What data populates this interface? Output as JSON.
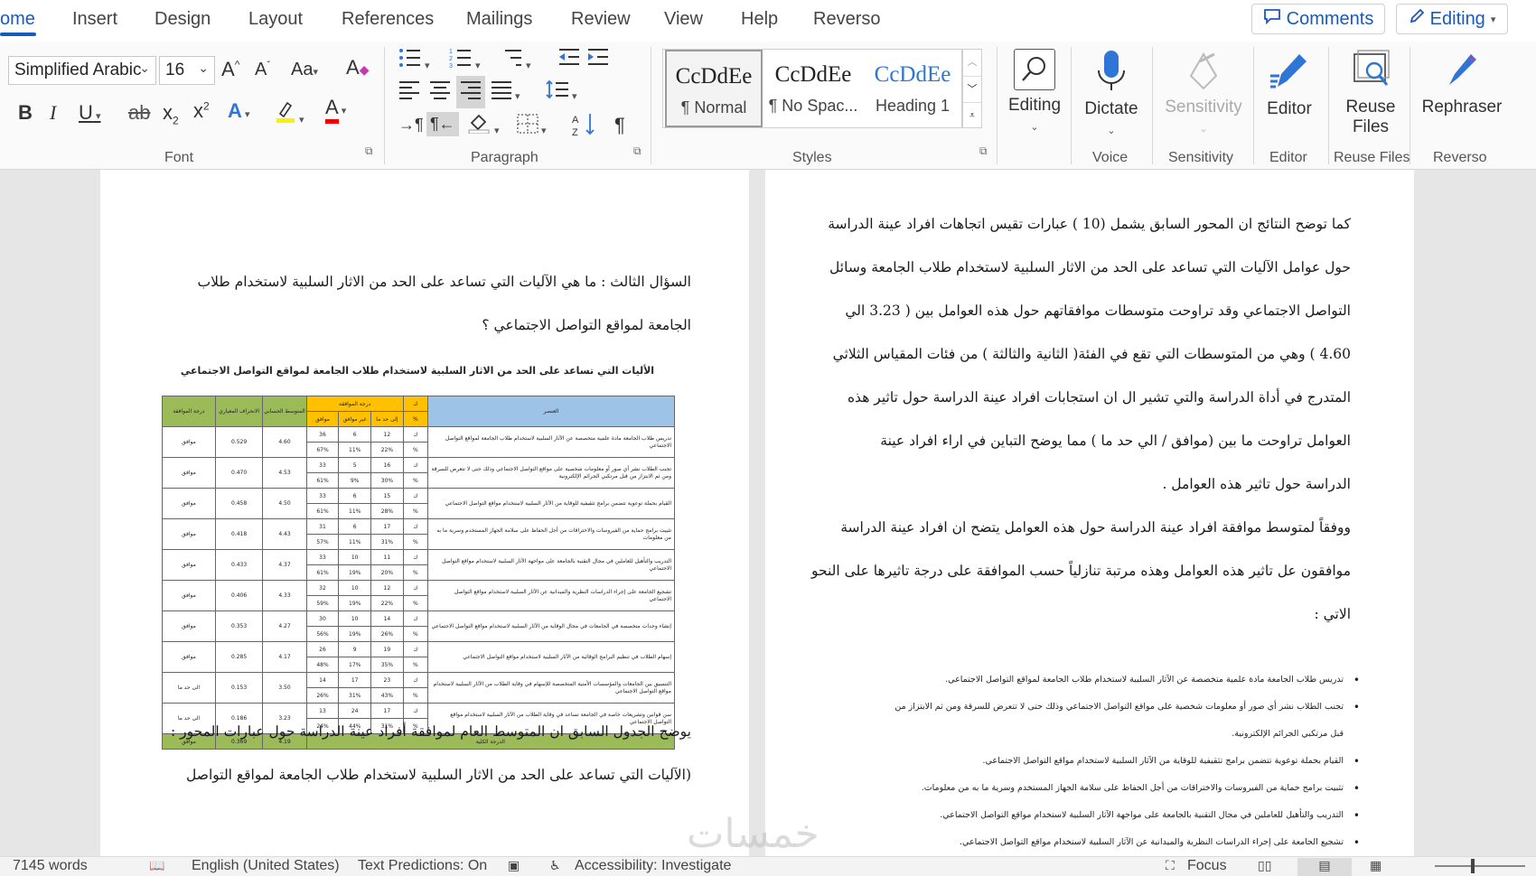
{
  "tabs": [
    {
      "label": "ome",
      "active": true
    },
    {
      "label": "Insert"
    },
    {
      "label": "Design"
    },
    {
      "label": "Layout"
    },
    {
      "label": "References"
    },
    {
      "label": "Mailings"
    },
    {
      "label": "Review"
    },
    {
      "label": "View"
    },
    {
      "label": "Help"
    },
    {
      "label": "Reverso"
    }
  ],
  "top_right": {
    "comments": "Comments",
    "editing": "Editing"
  },
  "font": {
    "name": "Simplified Arabic",
    "size": "16",
    "group_label": "Font"
  },
  "paragraph": {
    "group_label": "Paragraph"
  },
  "styles": {
    "group_label": "Styles",
    "items": [
      {
        "sample": "CcDdEe",
        "name": "¶ Normal"
      },
      {
        "sample": "CcDdEe",
        "name": "¶ No Spac..."
      },
      {
        "sample": "CcDdEe",
        "name": "Heading 1"
      }
    ]
  },
  "big_buttons": {
    "editing": "Editing",
    "dictate": "Dictate",
    "sensitivity": "Sensitivity",
    "editor": "Editor",
    "reuse_files": "Reuse Files",
    "rephraser": "Rephraser"
  },
  "group_labels": {
    "voice": "Voice",
    "sensitivity": "Sensitivity",
    "editor": "Editor",
    "reuse_files": "Reuse Files",
    "reverso": "Reverso"
  },
  "left_page": {
    "question_line1": "السؤال الثالث : ما هي الآليات التي تساعد على الحد من الاثار السلبية لاستخدام طلاب",
    "question_line2": "الجامعة لمواقع التواصل الاجتماعي ؟",
    "table_title": "الأليات التي تساعد على الحد من الاثار السلبية لاستخدام طلاب الجامعة لمواقع التواصل الاجتماعي",
    "table_head": {
      "item": "العنصر",
      "k": "ك",
      "pct": "%",
      "agree_degree": "درجة الموافقة",
      "agree": "موافق",
      "neutral": "غير موافق",
      "somewhat": "إلى حد ما",
      "mean": "المتوسط الحسابي",
      "sd": "الانحراف المعياري",
      "level": "درجة الموافقة"
    },
    "rows": [
      {
        "text": "تدريس طلاب الجامعة مادة علمية متخصصة عن الآثار السلبية لاستخدام طلاب الجامعة لمواقع التواصل الاجتماعي",
        "a": "36",
        "b": "6",
        "c": "12",
        "pa": "67%",
        "pb": "11%",
        "pc": "22%",
        "mean": "4.60",
        "sd": "0.529",
        "level": "موافق"
      },
      {
        "text": "تجنب الطلاب نشر أي صور أو معلومات شخصية على مواقع التواصل الاجتماعي وذلك حتى لا تتعرض للسرقة ومن ثم الابتزاز من قبل مرتكبي الجرائم الإلكترونية",
        "a": "33",
        "b": "5",
        "c": "16",
        "pa": "61%",
        "pb": "9%",
        "pc": "30%",
        "mean": "4.53",
        "sd": "0.470",
        "level": "موافق"
      },
      {
        "text": "القيام بحملة توعوية تتضمن برامج تثقيفية للوقاية من الآثار السلبية لاستخدام مواقع التواصل الاجتماعي",
        "a": "33",
        "b": "6",
        "c": "15",
        "pa": "61%",
        "pb": "11%",
        "pc": "28%",
        "mean": "4.50",
        "sd": "0.458",
        "level": "موافق"
      },
      {
        "text": "تثبيت برامج حماية من الفيروسات والاختراقات من أجل الحفاظ على سلامة الجهاز المستخدم وسرية ما به من معلومات",
        "a": "31",
        "b": "6",
        "c": "17",
        "pa": "57%",
        "pb": "11%",
        "pc": "31%",
        "mean": "4.43",
        "sd": "0.418",
        "level": "موافق"
      },
      {
        "text": "التدريب والتأهيل للعاملين في مجال التقنية بالجامعة على مواجهة الآثار السلبية لاستخدام مواقع التواصل الاجتماعي",
        "a": "33",
        "b": "10",
        "c": "11",
        "pa": "61%",
        "pb": "19%",
        "pc": "20%",
        "mean": "4.37",
        "sd": "0.433",
        "level": "موافق"
      },
      {
        "text": "تشجيع الجامعة على إجراء الدراسات النظرية والميدانية عن الآثار السلبية لاستخدام مواقع التواصل الاجتماعي",
        "a": "32",
        "b": "10",
        "c": "12",
        "pa": "59%",
        "pb": "19%",
        "pc": "22%",
        "mean": "4.33",
        "sd": "0.406",
        "level": "موافق"
      },
      {
        "text": "إنشاء وحدات متخصصة في الجامعات في مجال الوقاية من الآثار السلبية لاستخدام مواقع التواصل الاجتماعي",
        "a": "30",
        "b": "10",
        "c": "14",
        "pa": "56%",
        "pb": "19%",
        "pc": "26%",
        "mean": "4.27",
        "sd": "0.353",
        "level": "موافق"
      },
      {
        "text": "إسهام الطلاب في تنظيم البرامج الوقائية من الآثار السلبية لاستخدام مواقع التواصل الاجتماعي",
        "a": "26",
        "b": "9",
        "c": "19",
        "pa": "48%",
        "pb": "17%",
        "pc": "35%",
        "mean": "4.17",
        "sd": "0.285",
        "level": "موافق"
      },
      {
        "text": "التنسيق بين الجامعات والمؤسسات الأمنية المتخصصة للإسهام في وقاية الطلاب من الآثار السلبية لاستخدام مواقع التواصل الاجتماعي",
        "a": "14",
        "b": "17",
        "c": "23",
        "pa": "26%",
        "pb": "31%",
        "pc": "43%",
        "mean": "3.50",
        "sd": "0.153",
        "level": "الى حد ما"
      },
      {
        "text": "سن قوانين وتشريعات خاصة في الجامعة تساعد في وقاية الطلاب من الآثار السلبية لاستخدام مواقع التواصل الاجتماعي",
        "a": "13",
        "b": "24",
        "c": "17",
        "pa": "24%",
        "pb": "44%",
        "pc": "31%",
        "mean": "3.23",
        "sd": "0.186",
        "level": "الى حد ما"
      }
    ],
    "total": {
      "label": "الدرجة الكلية",
      "mean": "4.19",
      "sd": "0.369",
      "level": "موافق"
    },
    "after_line1": "يوضح الجدول السابق ان المتوسط العام لموافقة أفراد عينة الدراسة حول عبارات المحور :",
    "after_line2": "(الآليات التي تساعد على الحد من الاثار السلبية لاستخدام طلاب الجامعة لمواقع التواصل"
  },
  "right_page": {
    "lines": [
      "كما توضح النتائج ان المحور السابق يشمل (10 ) عبارات تقيس اتجاهات افراد عينة الدراسة",
      "حول عوامل الآليات التي تساعد على الحد من الاثار السلبية لاستخدام طلاب الجامعة وسائل",
      "التواصل الاجتماعي وقد تراوحت متوسطات موافقاتهم حول هذه العوامل بين ( 3.23 الي",
      "4.60 ) وهي من المتوسطات التي تقع في الفئة( الثانية والثالثة ) من فئات المقياس الثلاثي",
      "المتدرج في أداة الدراسة والتي تشير ال ان استجابات افراد عينة الدراسة حول تاثير هذه",
      "العوامل تراوحت ما بين  (موافق / الي حد ما  ) مما يوضح التباين في اراء افراد عينة",
      "الدراسة حول تاثير  هذه العوامل .",
      "ووفقاً لمتوسط موافقة افراد عينة الدراسة حول هذه العوامل يتضح ان افراد عينة الدراسة",
      "موافقون عل تاثير هذه العوامل وهذه مرتبة تنازلياً حسب الموافقة على درجة تاثيرها على النحو",
      "الاتي :"
    ],
    "bullets": [
      "تدريس طلاب الجامعة مادة علمية متخصصة عن الآثار السلبية لاستخدام طلاب الجامعة لمواقع التواصل الاجتماعي.",
      "تجنب الطلاب نشر أي صور أو معلومات شخصية على مواقع التواصل الاجتماعي وذلك حتى لا تتعرض للسرقة ومن ثم الابتزاز من",
      "قبل مرتكبي الجرائم الإلكترونية.",
      "القيام بحملة توعوية تتضمن برامج تثقيفية للوقاية من الآثار السلبية لاستخدام مواقع التواصل الاجتماعي.",
      "تثبيت برامج حماية من الفيروسات والاختراقات من أجل الحفاظ على سلامة الجهاز المستخدم وسرية ما به من معلومات.",
      "التدريب والتأهيل للعاملين في مجال التقنية بالجامعة على مواجهة الآثار السلبية لاستخدام مواقع التواصل الاجتماعي.",
      "تشجيع الجامعة على إجراء الدراسات النظرية والميدانية عن الآثار السلبية لاستخدام مواقع التواصل الاجتماعي."
    ]
  },
  "status": {
    "words": "7145 words",
    "language": "English (United States)",
    "predictions": "Text Predictions: On",
    "accessibility": "Accessibility: Investigate",
    "focus": "Focus"
  },
  "watermark": "خمسات",
  "colors": {
    "accent": "#185abd",
    "table_green": "#9bbb59",
    "table_yellow": "#ffc000",
    "table_blue": "#9dc3e6"
  }
}
